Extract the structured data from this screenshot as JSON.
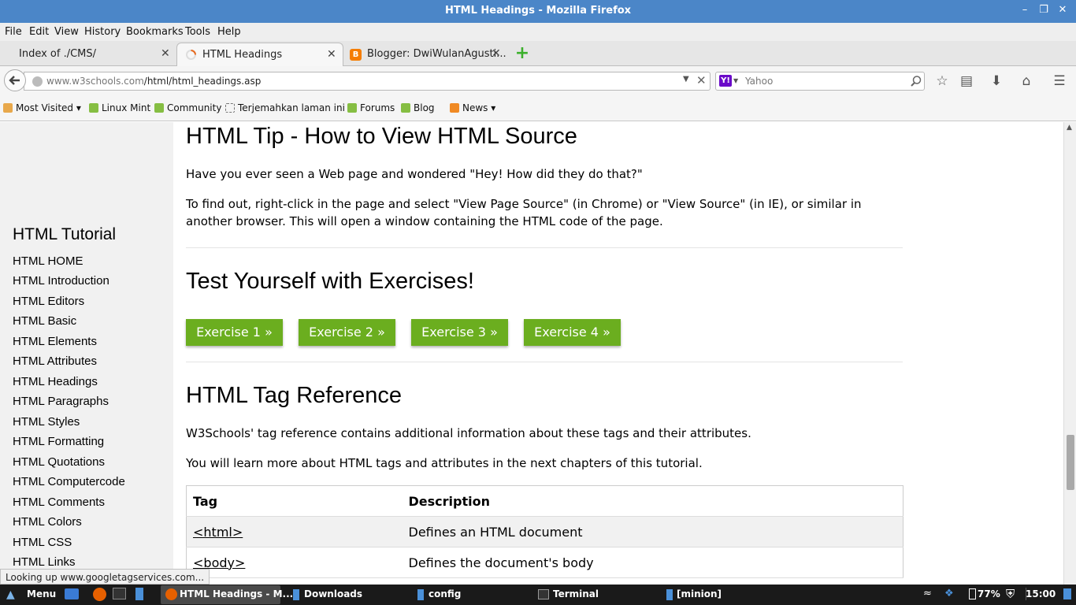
{
  "window": {
    "title": "HTML Headings - Mozilla Firefox"
  },
  "menu": [
    "File",
    "Edit",
    "View",
    "History",
    "Bookmarks",
    "Tools",
    "Help"
  ],
  "tabs": [
    {
      "label": "Index of ./CMS/"
    },
    {
      "label": "HTML Headings"
    },
    {
      "label": "Blogger: DwiWulanAgusti..."
    }
  ],
  "nav": {
    "url_host": "www.w3schools.com",
    "url_path": "/html/html_headings.asp",
    "search_engine": "Yahoo",
    "search_placeholder": "Yahoo"
  },
  "bookmarks": [
    "Most Visited",
    "Linux Mint",
    "Community",
    "Terjemahkan laman ini",
    "Forums",
    "Blog",
    "News"
  ],
  "sidebar": {
    "title": "HTML Tutorial",
    "items": [
      "HTML HOME",
      "HTML Introduction",
      "HTML Editors",
      "HTML Basic",
      "HTML Elements",
      "HTML Attributes",
      "HTML Headings",
      "HTML Paragraphs",
      "HTML Styles",
      "HTML Formatting",
      "HTML Quotations",
      "HTML Computercode",
      "HTML Comments",
      "HTML Colors",
      "HTML CSS",
      "HTML Links"
    ]
  },
  "main": {
    "tip_heading": "HTML Tip - How to View HTML Source",
    "tip_p1": "Have you ever seen a Web page and wondered \"Hey! How did they do that?\"",
    "tip_p2": "To find out, right-click in the page and select \"View Page Source\" (in Chrome) or \"View Source\" (in IE), or similar in another browser. This will open a window containing the HTML code of the page.",
    "exercises_heading": "Test Yourself with Exercises!",
    "exercises": [
      "Exercise 1 »",
      "Exercise 2 »",
      "Exercise 3 »",
      "Exercise 4 »"
    ],
    "ref_heading": "HTML Tag Reference",
    "ref_p1": "W3Schools' tag reference contains additional information about these tags and their attributes.",
    "ref_p2": "You will learn more about HTML tags and attributes in the next chapters of this tutorial.",
    "table": {
      "headers": [
        "Tag",
        "Description"
      ],
      "rows": [
        [
          "<html>",
          "Defines an HTML document"
        ],
        [
          "<body>",
          "Defines the document's body"
        ]
      ]
    }
  },
  "status": "Looking up www.googletagservices.com...",
  "taskbar": {
    "menu": "Menu",
    "windows": [
      "HTML Headings - M...",
      "Downloads",
      "config",
      "Terminal",
      "[minion]"
    ],
    "battery": "77%",
    "clock": "15:00"
  },
  "colors": {
    "titlebar": "#4b86c8",
    "exercise_button": "#6bae1f",
    "taskbar": "#1a1a1a"
  }
}
